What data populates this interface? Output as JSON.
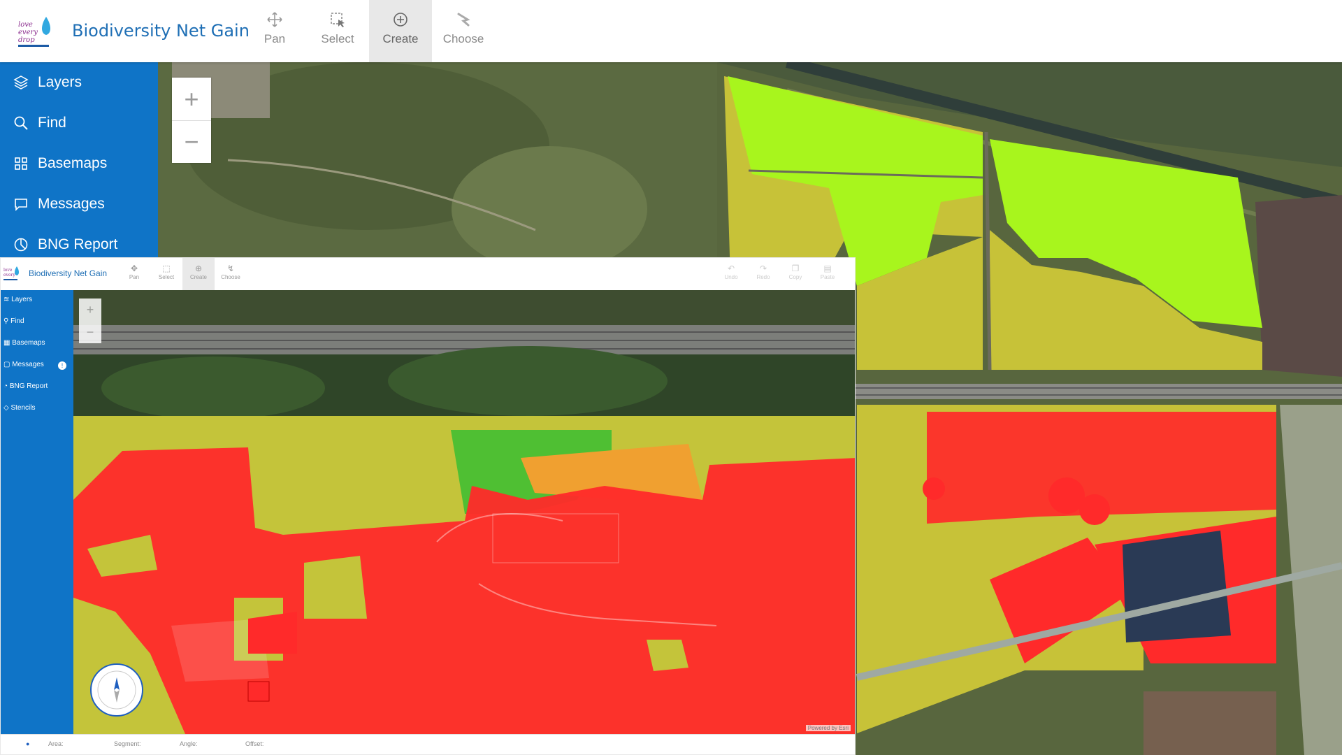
{
  "header": {
    "title": "Biodiversity Net Gain",
    "tools": [
      {
        "label": "Pan",
        "icon": "pan-icon"
      },
      {
        "label": "Select",
        "icon": "select-icon"
      },
      {
        "label": "Create",
        "icon": "create-icon",
        "active": true
      },
      {
        "label": "Choose",
        "icon": "choose-icon"
      }
    ]
  },
  "sidebar": {
    "items": [
      {
        "label": "Layers",
        "icon": "layers-icon"
      },
      {
        "label": "Find",
        "icon": "search-icon"
      },
      {
        "label": "Basemaps",
        "icon": "basemaps-icon"
      },
      {
        "label": "Messages",
        "icon": "messages-icon"
      },
      {
        "label": "BNG Report",
        "icon": "report-icon"
      }
    ]
  },
  "map": {
    "zoom_in": "+",
    "zoom_out": "−"
  },
  "inset": {
    "title": "Biodiversity Net Gain",
    "tools": [
      {
        "label": "Pan"
      },
      {
        "label": "Select"
      },
      {
        "label": "Create",
        "active": true
      },
      {
        "label": "Choose"
      }
    ],
    "edit_tools": [
      {
        "label": "Undo"
      },
      {
        "label": "Redo"
      },
      {
        "label": "Copy"
      },
      {
        "label": "Paste"
      }
    ],
    "sidebar": [
      {
        "label": "Layers"
      },
      {
        "label": "Find"
      },
      {
        "label": "Basemaps"
      },
      {
        "label": "Messages",
        "badge": "!"
      },
      {
        "label": "BNG Report"
      },
      {
        "label": "Stencils"
      }
    ],
    "status": {
      "area_label": "Area:",
      "segment_label": "Segment:",
      "angle_label": "Angle:",
      "offset_label": "Offset:"
    },
    "powered": "Powered by Esri"
  },
  "colors": {
    "brand_blue": "#0f74c7",
    "title_blue": "#1f6fb5",
    "habitat_red": "#ff2a2a",
    "habitat_yellow": "#c9c73a",
    "habitat_lime": "#a6ff1a",
    "habitat_orange": "#f0a030"
  }
}
